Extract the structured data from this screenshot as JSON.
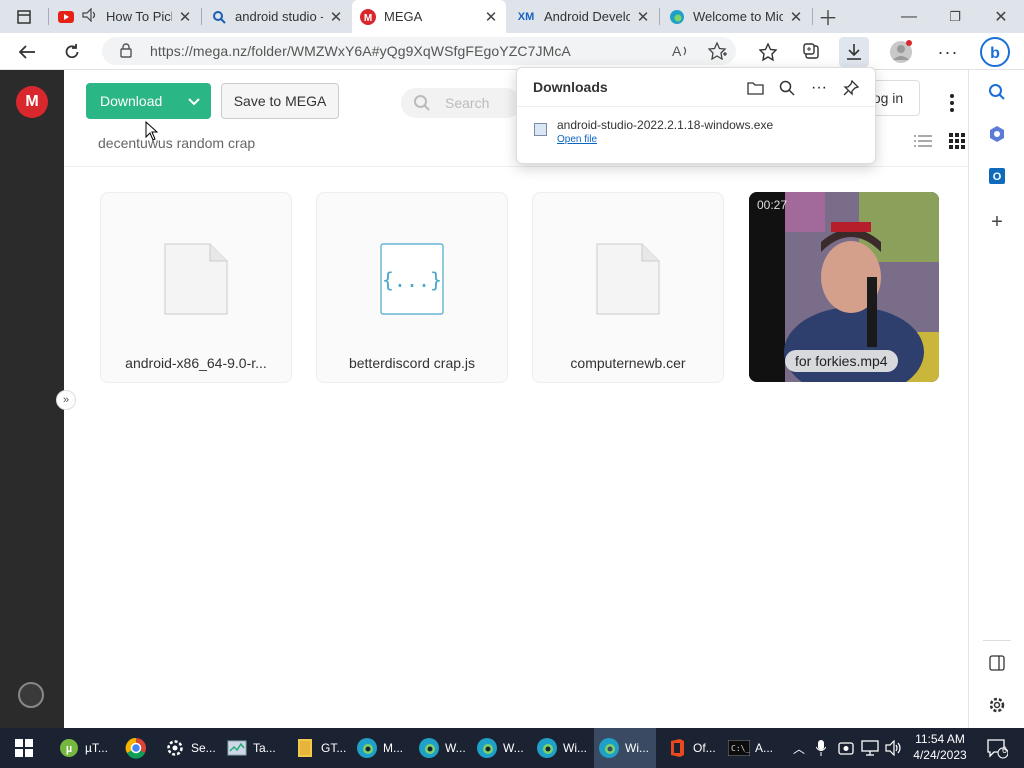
{
  "browser": {
    "tabs": [
      {
        "title": "How To Pick",
        "icon": "youtube-icon",
        "audio": true
      },
      {
        "title": "android studio -",
        "icon": "search-icon"
      },
      {
        "title": "MEGA",
        "icon": "mega-icon",
        "active": true
      },
      {
        "title": "Android Develop",
        "icon": "xm-icon"
      },
      {
        "title": "Welcome to Mic",
        "icon": "edge-icon"
      }
    ],
    "address": "https://mega.nz/folder/WMZWxY6A#yQg9XqWSfgFEgoYZC7JMcA"
  },
  "downloads_panel": {
    "title": "Downloads",
    "item": {
      "filename": "android-studio-2022.2.1.18-windows.exe",
      "action": "Open file"
    }
  },
  "mega": {
    "logo": "M",
    "download_label": "Download",
    "save_label": "Save to MEGA",
    "search_placeholder": "Search",
    "login_label": "Log in",
    "login_visible_text": "og in",
    "folder_name": "decentuwus random crap",
    "files": [
      {
        "name": "android-x86_64-9.0-r...",
        "type": "generic"
      },
      {
        "name": "betterdiscord crap.js",
        "type": "code"
      },
      {
        "name": "computernewb.cer",
        "type": "generic"
      },
      {
        "name": "for forkies.mp4",
        "type": "video",
        "duration": "00:27"
      }
    ]
  },
  "taskbar": {
    "items": [
      {
        "label": "µT...",
        "icon": "utorrent-icon"
      },
      {
        "label": "",
        "icon": "chrome-icon"
      },
      {
        "label": "Se...",
        "icon": "settings-icon"
      },
      {
        "label": "Ta...",
        "icon": "task-manager-icon"
      },
      {
        "label": "GT...",
        "icon": "folder-icon"
      },
      {
        "label": "M...",
        "icon": "edge-icon"
      },
      {
        "label": "W...",
        "icon": "edge-icon"
      },
      {
        "label": "W...",
        "icon": "edge-icon"
      },
      {
        "label": "Wi...",
        "icon": "edge-icon"
      },
      {
        "label": "Wi...",
        "icon": "edge-icon",
        "active": true
      },
      {
        "label": "Of...",
        "icon": "office-icon"
      },
      {
        "label": "A...",
        "icon": "terminal-icon"
      }
    ],
    "time": "11:54 AM",
    "date": "4/24/2023",
    "notifications": "6"
  },
  "colors": {
    "mega_red": "#d9272e",
    "mega_green": "#2bb685",
    "taskbar": "#1b2333"
  }
}
